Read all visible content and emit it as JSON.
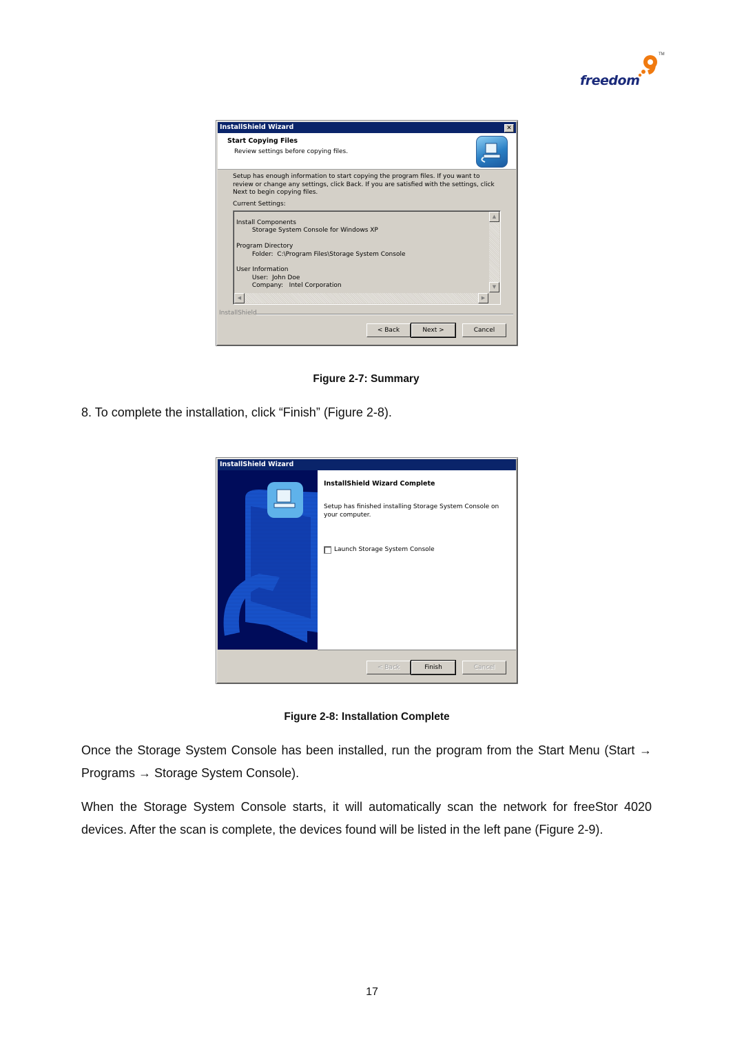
{
  "logo": {
    "text": "freedom",
    "nine": "9",
    "tm": "TM",
    "brand_color": "#1a2a7a",
    "accent_color": "#f07a10"
  },
  "figure7": {
    "window_title": "InstallShield Wizard",
    "header_title": "Start Copying Files",
    "header_subtitle": "Review settings before copying files.",
    "description": "Setup has enough information to start copying the program files.  If you want to review or change any settings, click Back.  If you are satisfied with the settings, click Next to begin copying files.",
    "current_settings_label": "Current Settings:",
    "settings_lines": [
      "Install Components",
      "        Storage System Console for Windows XP",
      "",
      "Program Directory",
      "        Folder:  C:\\Program Files\\Storage System Console",
      "",
      "User Information",
      "        User:  John Doe",
      "        Company:   Intel Corporation"
    ],
    "brand_label": "InstallShield",
    "buttons": {
      "back": "< Back",
      "next": "Next >",
      "cancel": "Cancel"
    },
    "caption": "Figure 2-7: Summary"
  },
  "step8": "8.   To complete the installation, click “Finish” (Figure 2-8).",
  "figure8": {
    "window_title": "InstallShield Wizard",
    "heading": "InstallShield Wizard Complete",
    "message": "Setup has finished installing Storage System Console on your computer.",
    "checkbox_label": "Launch Storage System Console",
    "checkbox_checked": false,
    "buttons": {
      "back": "< Back",
      "finish": "Finish",
      "cancel": "Cancel"
    },
    "caption": "Figure 2-8: Installation Complete"
  },
  "paragraphs": [
    "Once the Storage System Console has been installed, run the program from the Start Menu (Start → Programs → Storage System Console).",
    "When the Storage System Console starts, it will automatically scan the network for freeStor 4020 devices. After the scan is complete, the devices found will be listed in the left pane (Figure 2-9)."
  ],
  "page_number": "17"
}
